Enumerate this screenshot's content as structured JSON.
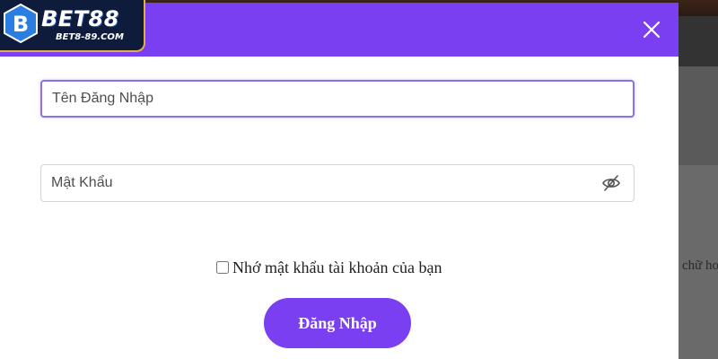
{
  "brand": {
    "name": "BET88",
    "badge_letter": "B",
    "domain": "BET8-89.COM"
  },
  "login_form": {
    "username_placeholder": "Tên Đăng Nhập",
    "password_placeholder": "Mật Khẩu",
    "remember_label": "Nhớ mật khẩu tài khoản của bạn",
    "remember_checked": false,
    "submit_label": "Đăng Nhập"
  },
  "background": {
    "partial_text": "chữ hơ"
  },
  "icons": {
    "close": "close-icon",
    "password_toggle": "eye-off-icon"
  },
  "colors": {
    "accent": "#7b3ff2",
    "logo_bg": "#0e1b3a",
    "logo_border": "#e2b04a"
  }
}
